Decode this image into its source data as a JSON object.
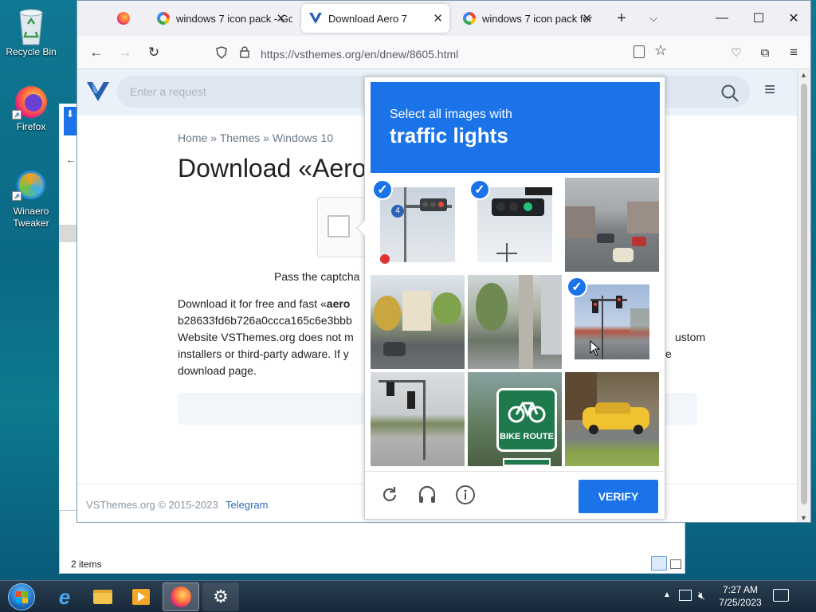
{
  "desktop": {
    "icons": [
      {
        "label": "Recycle Bin"
      },
      {
        "label": "Firefox"
      },
      {
        "label": "Winaero Tweaker"
      }
    ]
  },
  "explorer": {
    "items_count": "2 items"
  },
  "browser": {
    "tabs": [
      {
        "label": ""
      },
      {
        "label": "windows 7 icon pack - Go"
      },
      {
        "label": "Download Aero 7"
      },
      {
        "label": "windows 7 icon pack for"
      }
    ],
    "url": "https://vsthemes.org/en/dnew/8605.html",
    "window_controls": {
      "minimize": "—",
      "maximize": "☐",
      "close": "✕"
    }
  },
  "site": {
    "search_placeholder": "Enter a request",
    "breadcrumb": {
      "home": "Home",
      "sep": "»",
      "themes": "Themes",
      "win10": "Windows 10"
    },
    "title": "Download «Aero",
    "pass_captcha": "Pass the captcha",
    "p_line1a": "Download it for free and fast «",
    "p_line1b": "aero",
    "p_line2": "b28633fd6b726a0ccca165c6e3bbb",
    "p_line3a": "Website VSThemes.org does not m",
    "p_line3b": "ustom",
    "p_line4a": "installers or third-party adware. If y",
    "p_line4b": "e",
    "p_line5": "download page.",
    "footer_copy": "VSThemes.org © 2015-2023",
    "footer_link": "Telegram"
  },
  "captcha": {
    "header_line1": "Select all images with",
    "header_line2": "traffic lights",
    "verify_label": "VERIFY",
    "bike_sign": "BIKE ROUTE",
    "tiles": [
      {
        "id": 1,
        "selected": true
      },
      {
        "id": 2,
        "selected": true
      },
      {
        "id": 3,
        "selected": false
      },
      {
        "id": 4,
        "selected": false
      },
      {
        "id": 5,
        "selected": false
      },
      {
        "id": 6,
        "selected": true
      },
      {
        "id": 7,
        "selected": false
      },
      {
        "id": 8,
        "selected": false
      },
      {
        "id": 9,
        "selected": false
      }
    ]
  },
  "taskbar": {
    "time": "7:27 AM",
    "date": "7/25/2023"
  },
  "colors": {
    "accent": "#1a73e8",
    "link": "#2a6fbb"
  }
}
